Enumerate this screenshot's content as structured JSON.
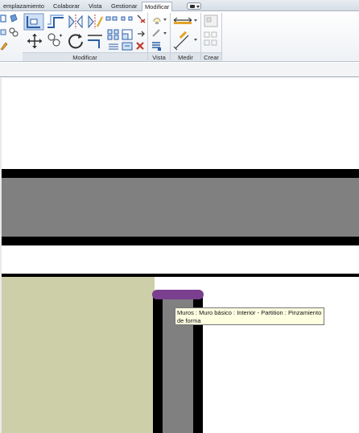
{
  "ribbon": {
    "tabs": [
      {
        "label": "emplazamiento",
        "active": false
      },
      {
        "label": "Colaborar",
        "active": false
      },
      {
        "label": "Vista",
        "active": false
      },
      {
        "label": "Gestionar",
        "active": false
      },
      {
        "label": "Modificar",
        "active": true
      }
    ],
    "panels": {
      "modificar": "Modificar",
      "vista": "Vista",
      "medir": "Medir",
      "crear": "Crear"
    }
  },
  "canvas": {
    "tooltip": "Muros : Muro básico : Interior - Partition : Pinzamiento de forma",
    "colors": {
      "wall_cut": "#000000",
      "wall_fill": "#808080",
      "floor_fill": "#cdcfa9",
      "grip_handle": "#7b3f8f"
    }
  },
  "icons": [
    "wall-join-icon",
    "align-icon",
    "offset-icon",
    "mirror-axis-icon",
    "mirror-draw-icon",
    "split-icon",
    "split-gap-icon",
    "unpin-icon",
    "move-icon",
    "copy-icon",
    "rotate-icon",
    "trim-extend-icon",
    "array-icon",
    "scale-icon",
    "pin-icon",
    "delete-icon",
    "hide-icon",
    "linework-icon",
    "measure-icon",
    "dimension-icon",
    "create-group-icon"
  ]
}
